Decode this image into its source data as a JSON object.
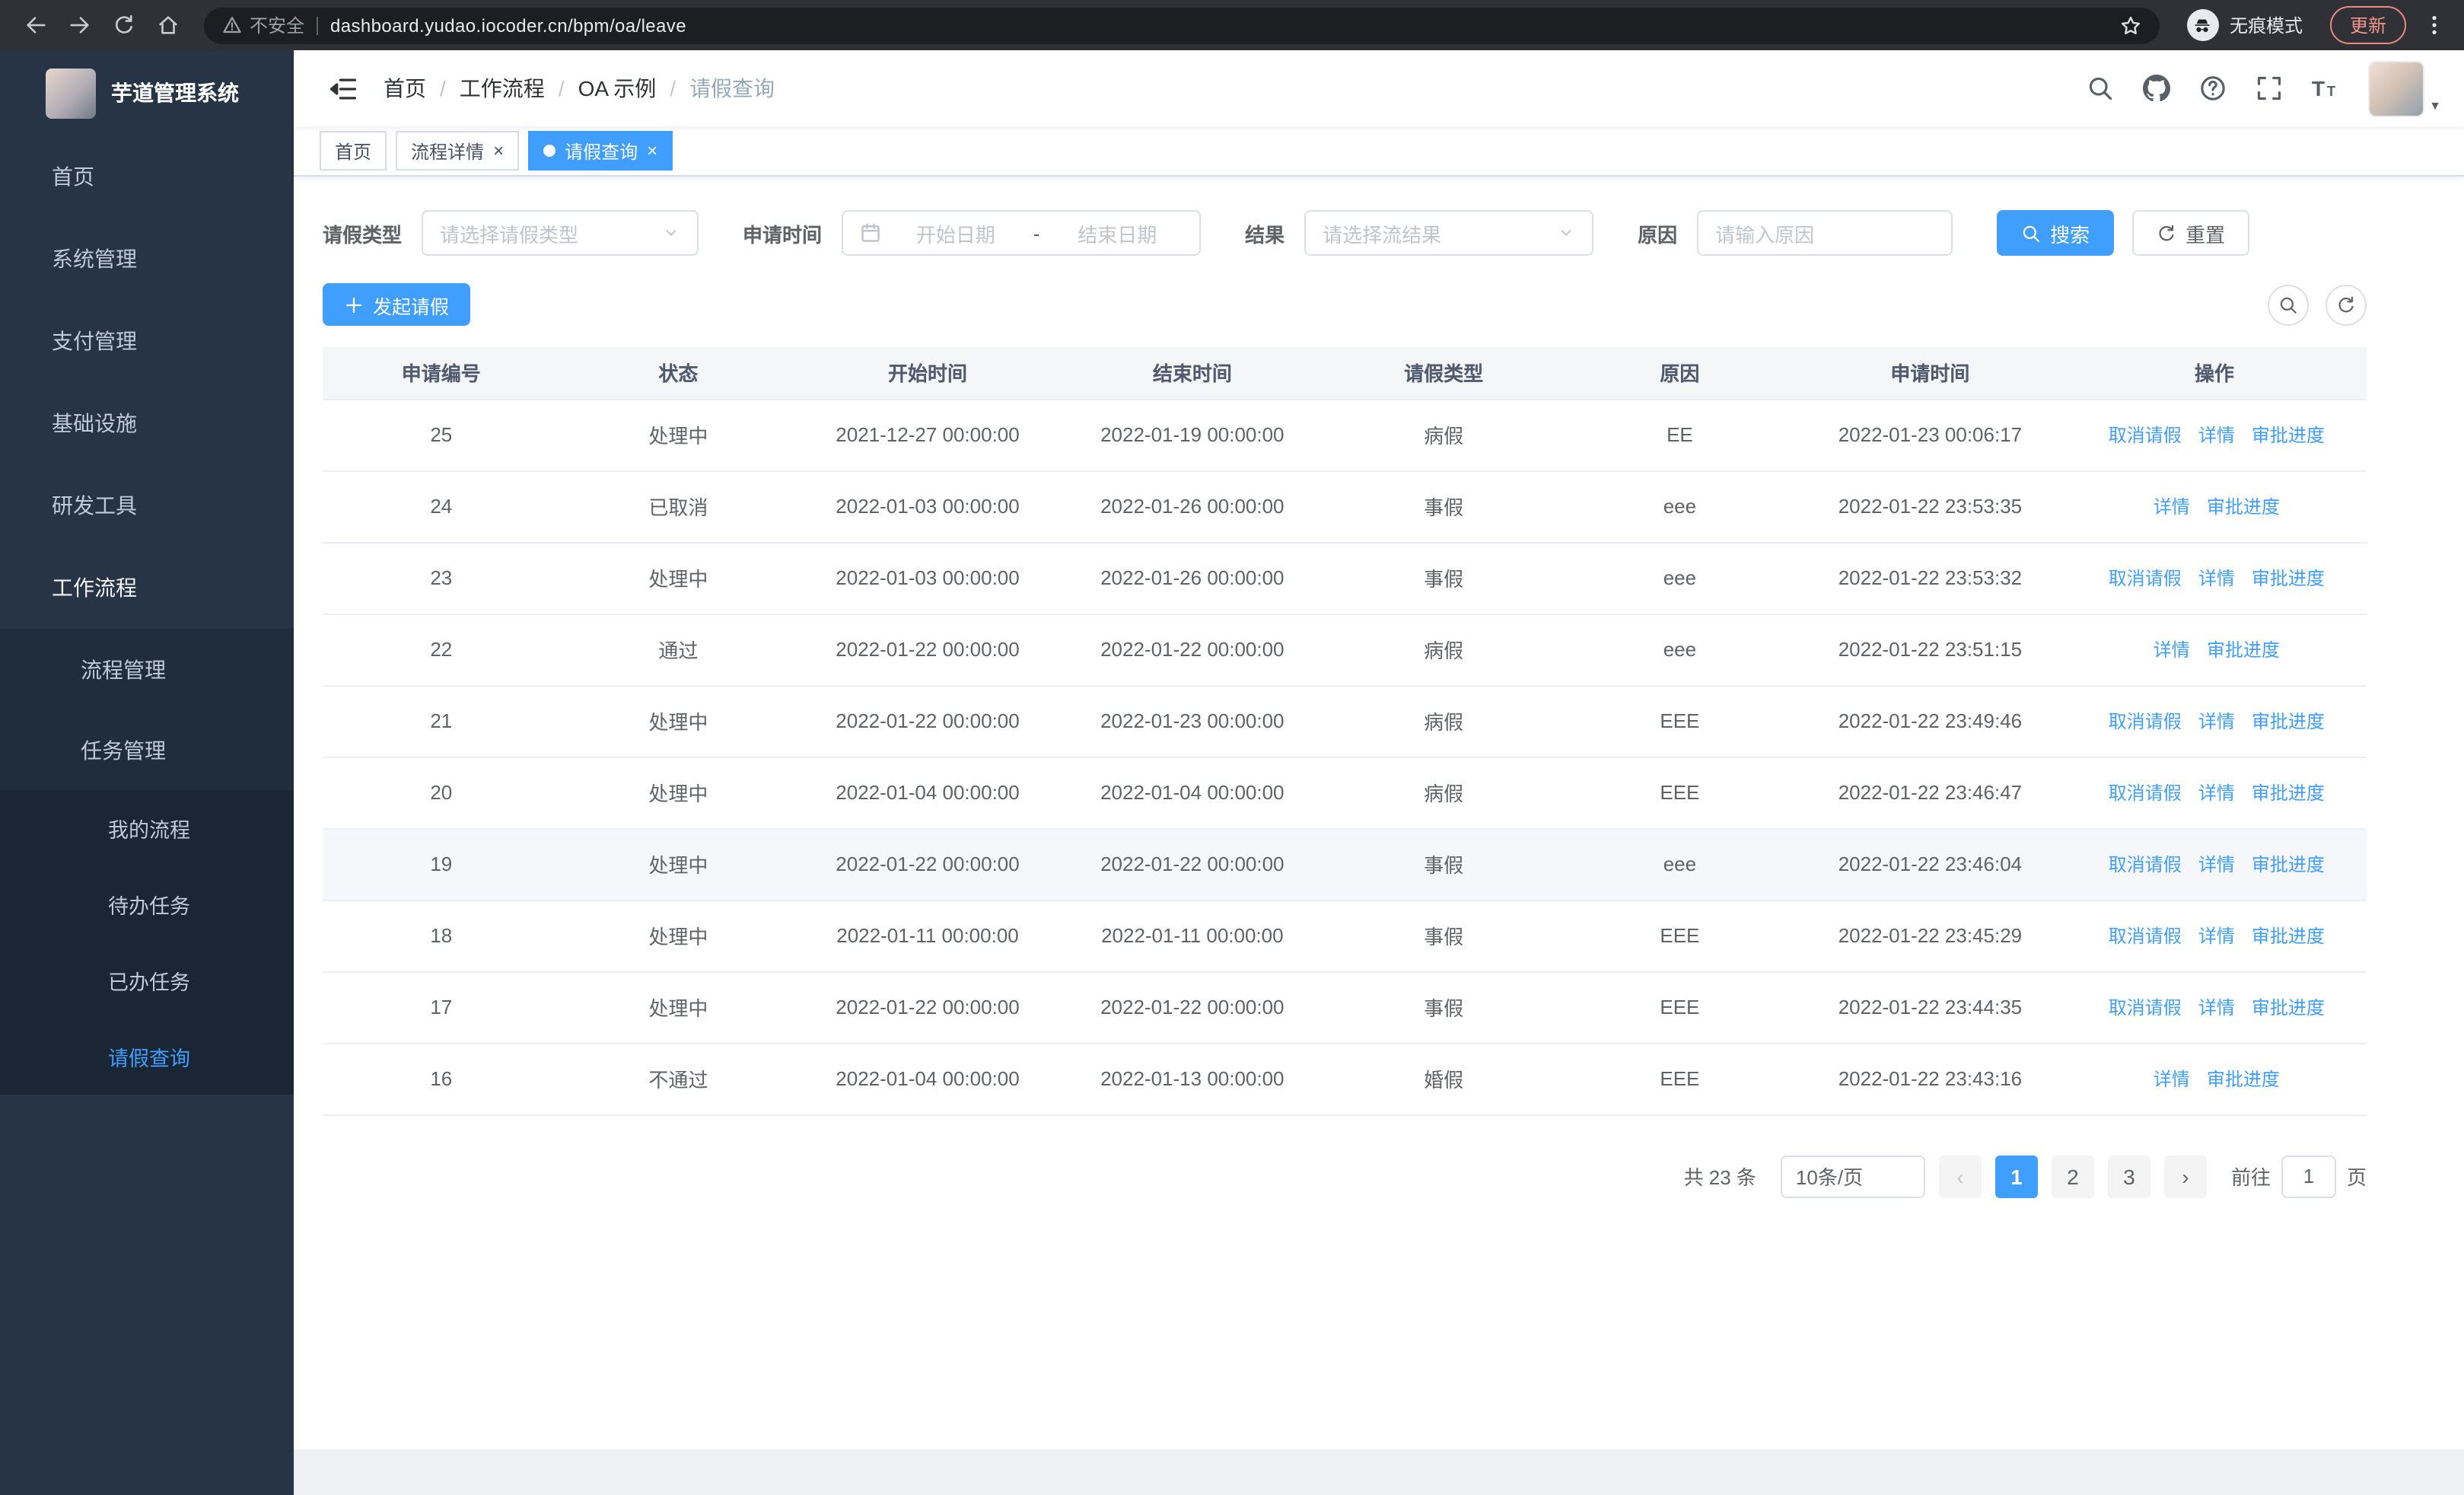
{
  "browser": {
    "warning": "不安全",
    "url": "dashboard.yudao.iocoder.cn/bpm/oa/leave",
    "incognito": "无痕模式",
    "update": "更新"
  },
  "sidebar": {
    "title": "芋道管理系统",
    "menu": [
      {
        "name": "home",
        "label": "首页",
        "icon": "dashboard",
        "level": 1
      },
      {
        "name": "system-management",
        "label": "系统管理",
        "icon": "gear",
        "level": 1,
        "chevron": "down"
      },
      {
        "name": "payment-management",
        "label": "支付管理",
        "icon": "yen",
        "level": 1,
        "chevron": "down"
      },
      {
        "name": "infrastructure",
        "label": "基础设施",
        "icon": "monitor",
        "level": 1,
        "chevron": "down"
      },
      {
        "name": "dev-tools",
        "label": "研发工具",
        "icon": "toolbox",
        "level": 1,
        "chevron": "down"
      },
      {
        "name": "workflow",
        "label": "工作流程",
        "icon": "briefcase",
        "level": 1,
        "chevron": "up",
        "trail": true
      },
      {
        "name": "process-management",
        "label": "流程管理",
        "icon": "list",
        "level": 2,
        "chevron": "down"
      },
      {
        "name": "task-management",
        "label": "任务管理",
        "icon": "flag",
        "level": 2,
        "chevron": "up"
      },
      {
        "name": "my-process",
        "label": "我的流程",
        "icon": "message",
        "level": 3
      },
      {
        "name": "todo-tasks",
        "label": "待办任务",
        "icon": "eye",
        "level": 3
      },
      {
        "name": "done-tasks",
        "label": "已办任务",
        "icon": "check-square",
        "level": 3
      },
      {
        "name": "leave-query",
        "label": "请假查询",
        "icon": "user",
        "level": 3,
        "active": true
      }
    ]
  },
  "header": {
    "breadcrumb": [
      "首页",
      "工作流程",
      "OA 示例",
      "请假查询"
    ]
  },
  "tabs": [
    {
      "name": "home",
      "label": "首页",
      "closable": false,
      "active": false
    },
    {
      "name": "process-detail",
      "label": "流程详情",
      "closable": true,
      "active": false
    },
    {
      "name": "leave-query",
      "label": "请假查询",
      "closable": true,
      "active": true
    }
  ],
  "filters": {
    "type_label": "请假类型",
    "type_placeholder": "请选择请假类型",
    "time_label": "申请时间",
    "start_placeholder": "开始日期",
    "range_separator": "-",
    "end_placeholder": "结束日期",
    "result_label": "结果",
    "result_placeholder": "请选择流结果",
    "reason_label": "原因",
    "reason_placeholder": "请输入原因",
    "search": "搜索",
    "reset": "重置"
  },
  "toolbar": {
    "create": "发起请假"
  },
  "table": {
    "headers": [
      "申请编号",
      "状态",
      "开始时间",
      "结束时间",
      "请假类型",
      "原因",
      "申请时间",
      "操作"
    ],
    "action_labels": {
      "cancel": "取消请假",
      "detail": "详情",
      "progress": "审批进度"
    },
    "rows": [
      {
        "id": "25",
        "status": "处理中",
        "start": "2021-12-27 00:00:00",
        "end": "2022-01-19 00:00:00",
        "type": "病假",
        "reason": "EE",
        "applied": "2022-01-23 00:06:17",
        "actions": [
          "cancel",
          "detail",
          "progress"
        ],
        "highlight": false
      },
      {
        "id": "24",
        "status": "已取消",
        "start": "2022-01-03 00:00:00",
        "end": "2022-01-26 00:00:00",
        "type": "事假",
        "reason": "eee",
        "applied": "2022-01-22 23:53:35",
        "actions": [
          "detail",
          "progress"
        ],
        "highlight": false
      },
      {
        "id": "23",
        "status": "处理中",
        "start": "2022-01-03 00:00:00",
        "end": "2022-01-26 00:00:00",
        "type": "事假",
        "reason": "eee",
        "applied": "2022-01-22 23:53:32",
        "actions": [
          "cancel",
          "detail",
          "progress"
        ],
        "highlight": false
      },
      {
        "id": "22",
        "status": "通过",
        "start": "2022-01-22 00:00:00",
        "end": "2022-01-22 00:00:00",
        "type": "病假",
        "reason": "eee",
        "applied": "2022-01-22 23:51:15",
        "actions": [
          "detail",
          "progress"
        ],
        "highlight": false
      },
      {
        "id": "21",
        "status": "处理中",
        "start": "2022-01-22 00:00:00",
        "end": "2022-01-23 00:00:00",
        "type": "病假",
        "reason": "EEE",
        "applied": "2022-01-22 23:49:46",
        "actions": [
          "cancel",
          "detail",
          "progress"
        ],
        "highlight": false
      },
      {
        "id": "20",
        "status": "处理中",
        "start": "2022-01-04 00:00:00",
        "end": "2022-01-04 00:00:00",
        "type": "病假",
        "reason": "EEE",
        "applied": "2022-01-22 23:46:47",
        "actions": [
          "cancel",
          "detail",
          "progress"
        ],
        "highlight": false
      },
      {
        "id": "19",
        "status": "处理中",
        "start": "2022-01-22 00:00:00",
        "end": "2022-01-22 00:00:00",
        "type": "事假",
        "reason": "eee",
        "applied": "2022-01-22 23:46:04",
        "actions": [
          "cancel",
          "detail",
          "progress"
        ],
        "highlight": true
      },
      {
        "id": "18",
        "status": "处理中",
        "start": "2022-01-11 00:00:00",
        "end": "2022-01-11 00:00:00",
        "type": "事假",
        "reason": "EEE",
        "applied": "2022-01-22 23:45:29",
        "actions": [
          "cancel",
          "detail",
          "progress"
        ],
        "highlight": false
      },
      {
        "id": "17",
        "status": "处理中",
        "start": "2022-01-22 00:00:00",
        "end": "2022-01-22 00:00:00",
        "type": "事假",
        "reason": "EEE",
        "applied": "2022-01-22 23:44:35",
        "actions": [
          "cancel",
          "detail",
          "progress"
        ],
        "highlight": false
      },
      {
        "id": "16",
        "status": "不通过",
        "start": "2022-01-04 00:00:00",
        "end": "2022-01-13 00:00:00",
        "type": "婚假",
        "reason": "EEE",
        "applied": "2022-01-22 23:43:16",
        "actions": [
          "detail",
          "progress"
        ],
        "highlight": false
      }
    ]
  },
  "pagination": {
    "total": "共 23 条",
    "page_size": "10条/页",
    "pages": [
      "1",
      "2",
      "3"
    ],
    "active_page": "1",
    "goto_label": "前往",
    "goto_value": "1",
    "page_label": "页"
  },
  "colors": {
    "accent": "#409eff",
    "sidebar_bg": "#263445",
    "sidebar_sub_bg": "#1f2d3d",
    "sidebar_deep_bg": "#1a2634"
  }
}
